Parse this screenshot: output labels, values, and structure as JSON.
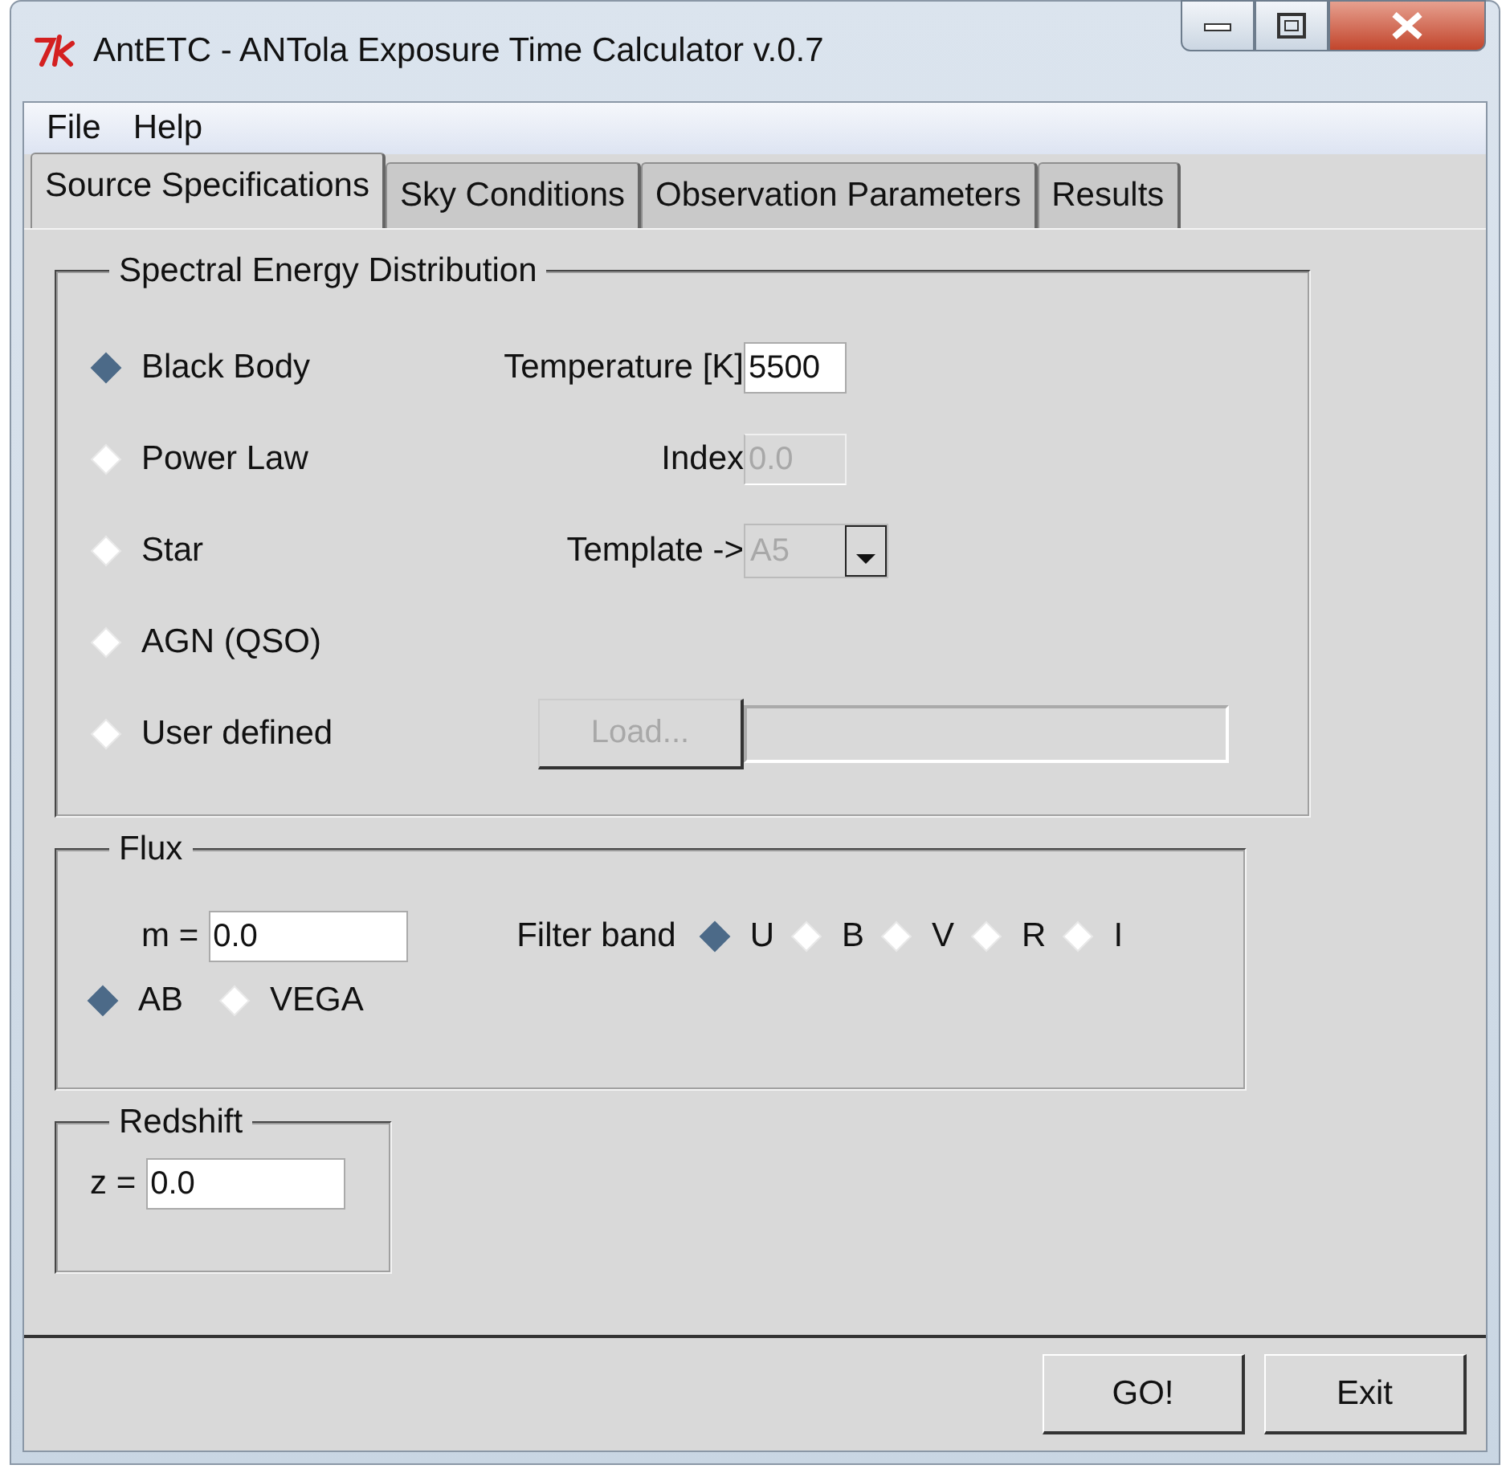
{
  "window": {
    "title": "AntETC - ANTola Exposure Time Calculator v.0.7"
  },
  "menu": [
    "File",
    "Help"
  ],
  "tabs": [
    {
      "label": "Source Specifications",
      "selected": true
    },
    {
      "label": "Sky Conditions",
      "selected": false
    },
    {
      "label": "Observation Parameters",
      "selected": false
    },
    {
      "label": "Results",
      "selected": false
    }
  ],
  "sed": {
    "title": "Spectral Energy Distribution",
    "options": [
      {
        "label": "Black Body",
        "selected": true,
        "control": {
          "kind": "entry",
          "label": "Temperature [K]",
          "value": "5500",
          "disabled": false
        }
      },
      {
        "label": "Power Law",
        "selected": false,
        "control": {
          "kind": "entry",
          "label": "Index",
          "value": "0.0",
          "disabled": true
        }
      },
      {
        "label": "Star",
        "selected": false,
        "control": {
          "kind": "dropdown",
          "label": "Template ->",
          "value": "A5",
          "disabled": true
        }
      },
      {
        "label": "AGN (QSO)",
        "selected": false
      },
      {
        "label": "User defined",
        "selected": false,
        "control": {
          "kind": "load",
          "button": "Load...",
          "disabled": true
        }
      }
    ]
  },
  "flux": {
    "title": "Flux",
    "m_label": "m =",
    "m_value": "0.0",
    "filter_label": "Filter band",
    "bands": [
      {
        "label": "U",
        "selected": true
      },
      {
        "label": "B",
        "selected": false
      },
      {
        "label": "V",
        "selected": false
      },
      {
        "label": "R",
        "selected": false
      },
      {
        "label": "I",
        "selected": false
      }
    ],
    "systems": [
      {
        "label": "AB",
        "selected": true
      },
      {
        "label": "VEGA",
        "selected": false
      }
    ]
  },
  "redshift": {
    "title": "Redshift",
    "label": "z =",
    "value": "0.0"
  },
  "buttons": [
    "GO!",
    "Exit"
  ]
}
